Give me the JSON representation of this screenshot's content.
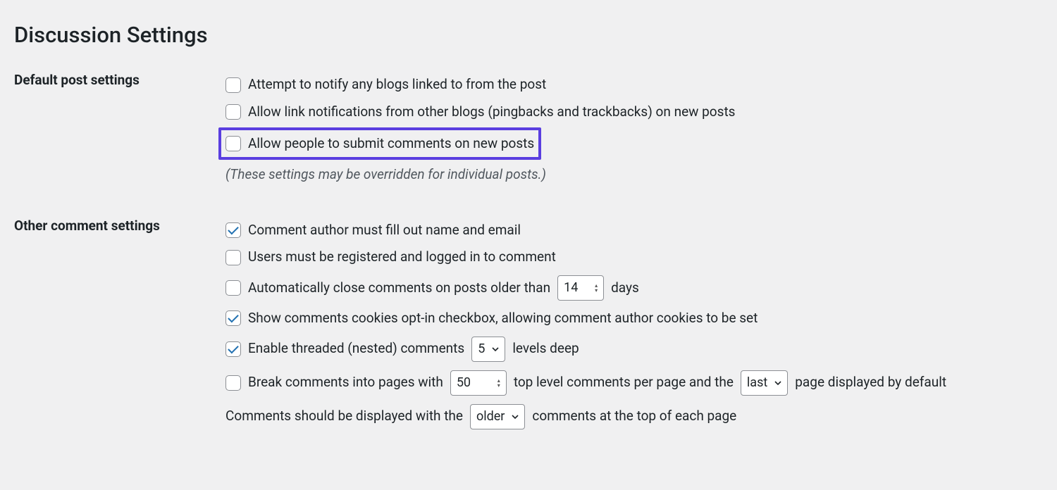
{
  "page": {
    "title": "Discussion Settings"
  },
  "sections": {
    "defaultPost": {
      "heading": "Default post settings",
      "opt1": {
        "label": "Attempt to notify any blogs linked to from the post",
        "checked": false
      },
      "opt2": {
        "label": "Allow link notifications from other blogs (pingbacks and trackbacks) on new posts",
        "checked": false
      },
      "opt3": {
        "label": "Allow people to submit comments on new posts",
        "checked": false
      },
      "note": "(These settings may be overridden for individual posts.)"
    },
    "otherComment": {
      "heading": "Other comment settings",
      "opt1": {
        "label": "Comment author must fill out name and email",
        "checked": true
      },
      "opt2": {
        "label": "Users must be registered and logged in to comment",
        "checked": false
      },
      "opt3": {
        "labelPre": "Automatically close comments on posts older than",
        "value": "14",
        "labelPost": "days",
        "checked": false
      },
      "opt4": {
        "label": "Show comments cookies opt-in checkbox, allowing comment author cookies to be set",
        "checked": true
      },
      "opt5": {
        "labelPre": "Enable threaded (nested) comments",
        "value": "5",
        "labelPost": "levels deep",
        "checked": true
      },
      "opt6": {
        "labelPre": "Break comments into pages with",
        "perPage": "50",
        "labelMid": "top level comments per page and the",
        "pagePos": "last",
        "labelPost": "page displayed by default",
        "checked": false
      },
      "opt7": {
        "labelPre": "Comments should be displayed with the",
        "order": "older",
        "labelPost": "comments at the top of each page"
      }
    }
  }
}
